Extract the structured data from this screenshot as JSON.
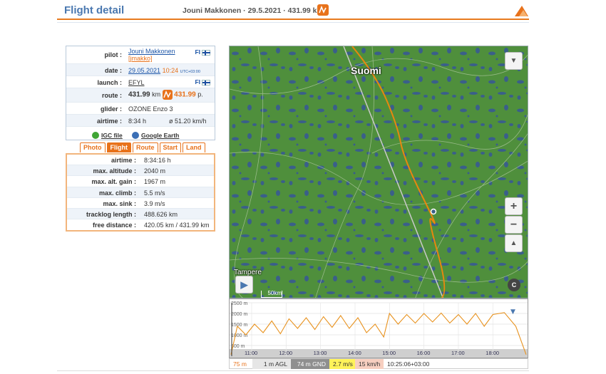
{
  "header": {
    "title": "Flight detail",
    "subtitle": "Jouni Makkonen · 29.5.2021 · 431.99 km"
  },
  "info": {
    "pilot_label": "pilot :",
    "pilot_name": "Jouni Makkonen",
    "pilot_user": "[jmakko]",
    "pilot_country": "FI",
    "date_label": "date :",
    "date_value": "29.05.2021",
    "time_value": "10:24",
    "utc": "UTC+03:00",
    "launch_label": "launch :",
    "launch_value": "EFYL",
    "launch_country": "FI",
    "route_label": "route :",
    "route_km": "431.99",
    "route_km_unit": "km",
    "route_points": "431.99",
    "route_points_unit": "p.",
    "glider_label": "glider :",
    "glider_value": "OZONE Enzo 3",
    "airtime_label": "airtime :",
    "airtime_value": "8:34 h",
    "speed_value": "ø 51.20 km/h",
    "igc_label": "IGC file",
    "earth_label": "Google Earth"
  },
  "tabs": [
    {
      "label": "Photo",
      "active": false
    },
    {
      "label": "Flight",
      "active": true
    },
    {
      "label": "Route",
      "active": false
    },
    {
      "label": "Start",
      "active": false
    },
    {
      "label": "Land",
      "active": false
    }
  ],
  "flight_stats": [
    {
      "label": "airtime :",
      "value": "8:34:16 h"
    },
    {
      "label": "max. altitude :",
      "value": "2040 m"
    },
    {
      "label": "max. alt. gain :",
      "value": "1967 m"
    },
    {
      "label": "max. climb :",
      "value": "5.5 m/s"
    },
    {
      "label": "max. sink :",
      "value": "3.9 m/s"
    },
    {
      "label": "tracklog length :",
      "value": "488.626 km"
    },
    {
      "label": "free distance :",
      "value": "420.05 km / 431.99 km"
    }
  ],
  "map": {
    "country_label": "Suomi",
    "city_label": "Tampere",
    "scale_label": "50km",
    "zoom_in": "+",
    "zoom_out": "−",
    "compass": "▲",
    "play": "▶",
    "copyright": "C"
  },
  "chart_data": {
    "type": "area",
    "ylabels": [
      "2500 m",
      "2000 m",
      "1500 m",
      "1000 m",
      "500 m"
    ],
    "xlabels": [
      "11:00",
      "12:00",
      "13:00",
      "14:00",
      "15:00",
      "16:00",
      "17:00",
      "18:00"
    ],
    "ylim": [
      0,
      2500
    ],
    "altitude_series": [
      {
        "t": "10:24",
        "alt": 75
      },
      {
        "t": "10:35",
        "alt": 1400
      },
      {
        "t": "10:50",
        "alt": 1000
      },
      {
        "t": "11:05",
        "alt": 1500
      },
      {
        "t": "11:20",
        "alt": 1100
      },
      {
        "t": "11:35",
        "alt": 1650
      },
      {
        "t": "11:50",
        "alt": 1050
      },
      {
        "t": "12:05",
        "alt": 1750
      },
      {
        "t": "12:20",
        "alt": 1300
      },
      {
        "t": "12:35",
        "alt": 1800
      },
      {
        "t": "12:50",
        "alt": 1250
      },
      {
        "t": "13:05",
        "alt": 1850
      },
      {
        "t": "13:20",
        "alt": 1350
      },
      {
        "t": "13:35",
        "alt": 1900
      },
      {
        "t": "13:50",
        "alt": 1300
      },
      {
        "t": "14:05",
        "alt": 1800
      },
      {
        "t": "14:20",
        "alt": 1100
      },
      {
        "t": "14:35",
        "alt": 1500
      },
      {
        "t": "14:50",
        "alt": 900
      },
      {
        "t": "15:00",
        "alt": 2000
      },
      {
        "t": "15:15",
        "alt": 1500
      },
      {
        "t": "15:30",
        "alt": 1950
      },
      {
        "t": "15:45",
        "alt": 1550
      },
      {
        "t": "16:00",
        "alt": 2000
      },
      {
        "t": "16:15",
        "alt": 1600
      },
      {
        "t": "16:30",
        "alt": 2020
      },
      {
        "t": "16:45",
        "alt": 1550
      },
      {
        "t": "17:00",
        "alt": 1950
      },
      {
        "t": "17:15",
        "alt": 1500
      },
      {
        "t": "17:30",
        "alt": 2000
      },
      {
        "t": "17:45",
        "alt": 1400
      },
      {
        "t": "18:00",
        "alt": 1950
      },
      {
        "t": "18:20",
        "alt": 2040
      },
      {
        "t": "18:40",
        "alt": 1400
      },
      {
        "t": "18:58",
        "alt": 75
      }
    ]
  },
  "status": {
    "alt": "75 m",
    "agl": "1 m AGL",
    "gnd": "74 m GND",
    "vario": "2.7 m/s",
    "speed": "15 km/h",
    "time": "10:25:06+03:00"
  }
}
